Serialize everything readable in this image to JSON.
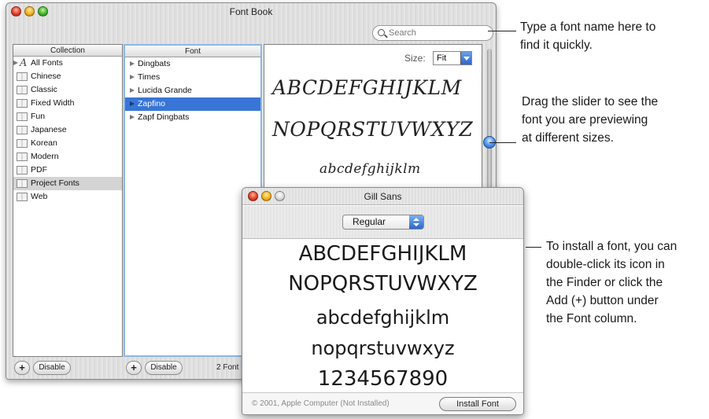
{
  "window": {
    "title": "Font Book",
    "search_placeholder": "Search"
  },
  "collection": {
    "header": "Collection",
    "items": [
      {
        "label": "All Fonts"
      },
      {
        "label": "Chinese"
      },
      {
        "label": "Classic"
      },
      {
        "label": "Fixed Width"
      },
      {
        "label": "Fun"
      },
      {
        "label": "Japanese"
      },
      {
        "label": "Korean"
      },
      {
        "label": "Modern"
      },
      {
        "label": "PDF"
      },
      {
        "label": "Project Fonts"
      },
      {
        "label": "Web"
      }
    ],
    "selected": "Project Fonts"
  },
  "fonts": {
    "header": "Font",
    "items": [
      {
        "label": "Dingbats"
      },
      {
        "label": "Times"
      },
      {
        "label": "Lucida Grande"
      },
      {
        "label": "Zapfino"
      },
      {
        "label": "Zapf Dingbats"
      }
    ],
    "selected": "Zapfino"
  },
  "preview": {
    "size_label": "Size:",
    "size_value": "Fit",
    "lines": [
      "ABCDEFGHIJKLM",
      "NOPQRSTUVWXYZ",
      "abcdefghijklm"
    ]
  },
  "toolbar": {
    "add_label": "+",
    "disable_label": "Disable",
    "font_count": "2 Font"
  },
  "font_window": {
    "title": "Gill Sans",
    "style": "Regular",
    "lines": [
      "ABCDEFGHIJKLM",
      "NOPQRSTUVWXYZ",
      "abcdefghijklm",
      "nopqrstuvwxyz",
      "1234567890"
    ],
    "copyright": "© 2001, Apple Computer (Not Installed)",
    "install_label": "Install Font"
  },
  "callouts": {
    "search": "Type a font name here to\nfind it quickly.",
    "slider": "Drag the slider to see the\nfont you are previewing\nat different sizes.",
    "install": "To install a font, you can\ndouble-click its icon in\nthe Finder or click the\nAdd (+) button under\nthe Font column."
  },
  "colors": {
    "selection_blue": "#3875d7",
    "selection_gray": "#d4d4d4",
    "close_red": "#e0402a",
    "minimize_yellow": "#f2b21c",
    "zoom_green": "#3fb82a"
  },
  "icons": [
    "search-icon",
    "book-icon",
    "all-fonts-icon",
    "disclosure-triangle-icon",
    "popup-arrow-icon"
  ]
}
